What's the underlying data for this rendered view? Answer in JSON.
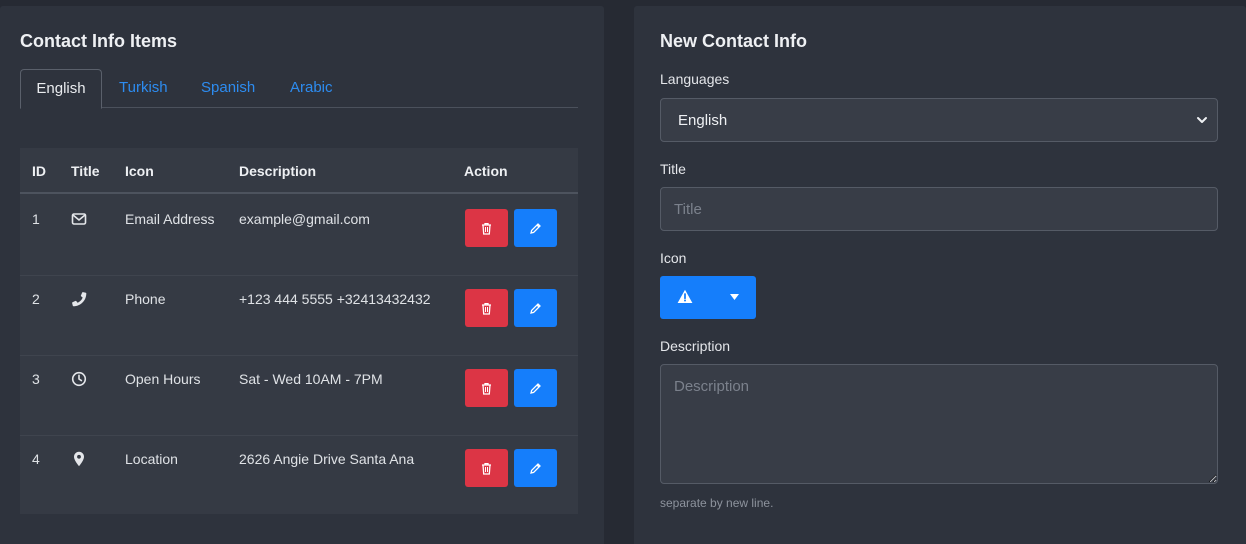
{
  "left_card": {
    "title": "Contact Info Items",
    "tabs": [
      {
        "label": "English",
        "active": true
      },
      {
        "label": "Turkish",
        "active": false
      },
      {
        "label": "Spanish",
        "active": false
      },
      {
        "label": "Arabic",
        "active": false
      }
    ],
    "table": {
      "headers": [
        "ID",
        "Title",
        "Icon",
        "Description",
        "Action"
      ],
      "rows": [
        {
          "id": "1",
          "icon": "envelope-icon",
          "title": "Email Address",
          "description": "example@gmail.com"
        },
        {
          "id": "2",
          "icon": "phone-icon",
          "title": "Phone",
          "description": "+123 444 5555 +32413432432"
        },
        {
          "id": "3",
          "icon": "clock-icon",
          "title": "Open Hours",
          "description": "Sat - Wed 10AM - 7PM"
        },
        {
          "id": "4",
          "icon": "map-marker-icon",
          "title": "Location",
          "description": "2626 Angie Drive Santa Ana"
        }
      ],
      "actions": {
        "delete_icon": "trash-icon",
        "edit_icon": "pencil-icon"
      }
    }
  },
  "right_card": {
    "title": "New Contact Info",
    "languages_label": "Languages",
    "languages_selected": "English",
    "title_label": "Title",
    "title_placeholder": "Title",
    "icon_label": "Icon",
    "icon_selected": "warning-icon",
    "description_label": "Description",
    "description_placeholder": "Description",
    "description_help": "separate by new line."
  },
  "colors": {
    "page_bg": "#262a33",
    "card_bg": "#2e333d",
    "table_bg": "#353a44",
    "link_blue": "#2d8cf0",
    "primary": "#157efb",
    "danger": "#dc3545"
  }
}
